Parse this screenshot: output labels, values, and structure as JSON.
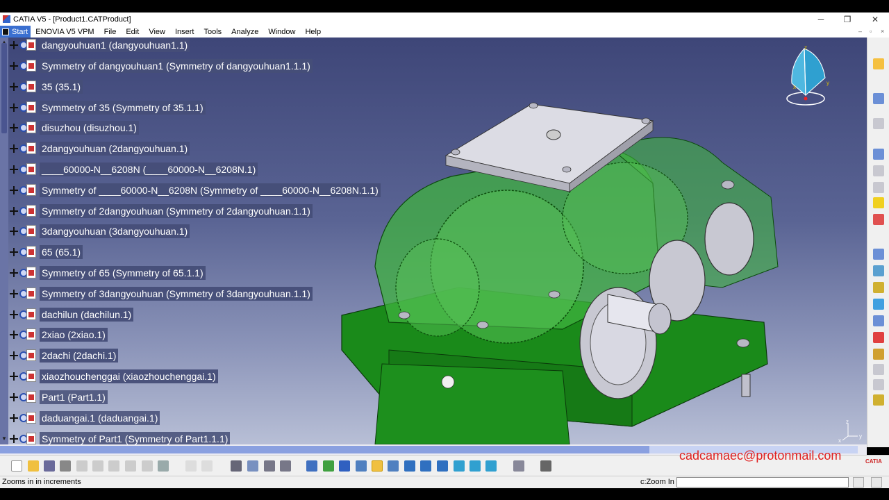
{
  "window": {
    "title": "CATIA V5 - [Product1.CATProduct]",
    "minimize": "─",
    "restore": "❐",
    "close": "✕"
  },
  "menu": {
    "start": "Start",
    "items": [
      "ENOVIA V5 VPM",
      "File",
      "Edit",
      "View",
      "Insert",
      "Tools",
      "Analyze",
      "Window",
      "Help"
    ]
  },
  "tree": {
    "items": [
      {
        "label": "dangyouhuan1 (dangyouhuan1.1)"
      },
      {
        "label": "Symmetry of dangyouhuan1 (Symmetry of dangyouhuan1.1.1)"
      },
      {
        "label": "35 (35.1)"
      },
      {
        "label": "Symmetry of 35 (Symmetry of 35.1.1)"
      },
      {
        "label": "disuzhou (disuzhou.1)"
      },
      {
        "label": "2dangyouhuan (2dangyouhuan.1)"
      },
      {
        "label": "____60000-N__6208N (____60000-N__6208N.1)"
      },
      {
        "label": "Symmetry of ____60000-N__6208N (Symmetry of ____60000-N__6208N.1.1)"
      },
      {
        "label": "Symmetry of 2dangyouhuan (Symmetry of 2dangyouhuan.1.1)"
      },
      {
        "label": "3dangyouhuan (3dangyouhuan.1)"
      },
      {
        "label": "65 (65.1)"
      },
      {
        "label": "Symmetry of 65 (Symmetry of 65.1.1)"
      },
      {
        "label": "Symmetry of 3dangyouhuan (Symmetry of 3dangyouhuan.1.1)"
      },
      {
        "label": "dachilun (dachilun.1)"
      },
      {
        "label": "2xiao (2xiao.1)"
      },
      {
        "label": "2dachi (2dachi.1)"
      },
      {
        "label": "xiaozhouchenggai (xiaozhouchenggai.1)"
      },
      {
        "label": "Part1 (Part1.1)"
      },
      {
        "label": "daduangai.1 (daduangai.1)"
      },
      {
        "label": "Symmetry of Part1 (Symmetry of Part1.1.1)"
      }
    ]
  },
  "compass": {
    "z": "z",
    "x": "x",
    "y": "y"
  },
  "mini_axis": {
    "z": "z",
    "x": "x",
    "y": "y"
  },
  "watermark": "cadcamaec@protonmail.com",
  "logo": "CATIA",
  "status": {
    "text": "Zooms in in increments",
    "command_label": "c:Zoom In",
    "command_value": ""
  },
  "colors": {
    "model_green": "#1f8a1f",
    "viewport_top": "#3e4678",
    "viewport_bottom": "#b8bfd6",
    "watermark": "#e02020"
  },
  "icons": {
    "bottom_toolbar": [
      "new-icon",
      "open-icon",
      "save-icon",
      "print-icon",
      "cut-icon",
      "copy-icon",
      "paste-icon",
      "undo-icon",
      "redo-icon",
      "whats-this-icon",
      "formula-icon",
      "knowledge-icon",
      "table-icon",
      "catalog-icon",
      "measure-icon",
      "analysis-icon",
      "fly-mode-icon",
      "fit-all-icon",
      "pan-icon",
      "rotate-icon",
      "zoom-in-icon",
      "zoom-out-icon",
      "normal-view-icon",
      "multi-view-icon",
      "iso-view-icon",
      "shading-icon",
      "hide-show-icon",
      "swap-space-icon",
      "spec-tree-icon",
      "capture-icon"
    ],
    "right_toolbar": [
      "select-icon",
      "product-icon",
      "insert-part-icon",
      "component-icon",
      "existing-component-icon",
      "replace-component-icon",
      "reorder-icon",
      "manipulate-icon",
      "snap-icon",
      "explode-icon",
      "clash-icon",
      "constraint-icon",
      "fix-icon",
      "contact-icon",
      "offset-icon",
      "angle-icon",
      "update-icon",
      "scene-icon",
      "catalog-browser-icon",
      "bill-of-material-icon",
      "publication-icon"
    ]
  }
}
